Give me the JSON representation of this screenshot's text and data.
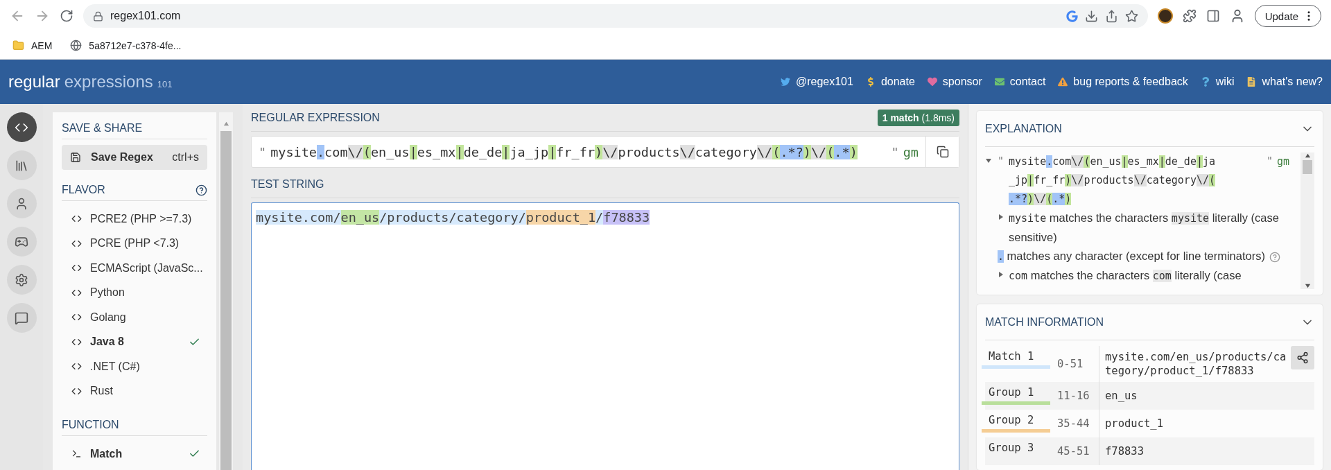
{
  "browser": {
    "address": "regex101.com",
    "update_button": "Update",
    "bookmarks": [
      {
        "label": "AEM",
        "kind": "folder"
      },
      {
        "label": "5a8712e7-c378-4fe...",
        "kind": "site"
      }
    ]
  },
  "header": {
    "logo_main": "regular",
    "logo_sub": "expressions",
    "logo_version": "101",
    "links": [
      {
        "label": "@regex101",
        "kind": "twitter"
      },
      {
        "label": "donate",
        "kind": "donate"
      },
      {
        "label": "sponsor",
        "kind": "sponsor"
      },
      {
        "label": "contact",
        "kind": "contact"
      },
      {
        "label": "bug reports & feedback",
        "kind": "bugs"
      },
      {
        "label": "wiki",
        "kind": "wiki"
      },
      {
        "label": "what's new?",
        "kind": "news"
      }
    ]
  },
  "icon_rail": [
    {
      "kind": "editor",
      "selected": true
    },
    {
      "kind": "library",
      "selected": false
    },
    {
      "kind": "account",
      "selected": false
    },
    {
      "kind": "quiz",
      "selected": false
    },
    {
      "kind": "settings",
      "selected": false
    },
    {
      "kind": "chat",
      "selected": false
    }
  ],
  "sidebar": {
    "save_share": {
      "title": "SAVE & SHARE",
      "save_button": "Save Regex",
      "shortcut": "ctrl+s"
    },
    "flavor": {
      "title": "FLAVOR",
      "items": [
        {
          "label": "PCRE2 (PHP >=7.3)",
          "selected": false
        },
        {
          "label": "PCRE (PHP <7.3)",
          "selected": false
        },
        {
          "label": "ECMAScript (JavaSc...",
          "selected": false
        },
        {
          "label": "Python",
          "selected": false
        },
        {
          "label": "Golang",
          "selected": false
        },
        {
          "label": "Java 8",
          "selected": true
        },
        {
          "label": ".NET (C#)",
          "selected": false
        },
        {
          "label": "Rust",
          "selected": false
        }
      ]
    },
    "function": {
      "title": "FUNCTION",
      "items": [
        {
          "label": "Match",
          "selected": true
        }
      ]
    }
  },
  "regex": {
    "title": "REGULAR EXPRESSION",
    "badge": "**1 match** (1.8ms)",
    "open_delimiter": "\"",
    "close_delimiter": "\"",
    "flags": "gm",
    "tokens": [
      {
        "text": "mysite",
        "kind": "text"
      },
      {
        "text": ".",
        "kind": "meta"
      },
      {
        "text": "com",
        "kind": "text"
      },
      {
        "text": "\\/",
        "kind": "escape"
      },
      {
        "text": "(",
        "kind": "group"
      },
      {
        "text": "en_us",
        "kind": "text"
      },
      {
        "text": "|",
        "kind": "group"
      },
      {
        "text": "es_mx",
        "kind": "text"
      },
      {
        "text": "|",
        "kind": "group"
      },
      {
        "text": "de_de",
        "kind": "text"
      },
      {
        "text": "|",
        "kind": "group"
      },
      {
        "text": "ja_jp",
        "kind": "text"
      },
      {
        "text": "|",
        "kind": "group"
      },
      {
        "text": "fr_fr",
        "kind": "text"
      },
      {
        "text": ")",
        "kind": "group"
      },
      {
        "text": "\\/",
        "kind": "escape"
      },
      {
        "text": "products",
        "kind": "text"
      },
      {
        "text": "\\/",
        "kind": "escape"
      },
      {
        "text": "category",
        "kind": "text"
      },
      {
        "text": "\\/",
        "kind": "escape"
      },
      {
        "text": "(",
        "kind": "group"
      },
      {
        "text": ".*?",
        "kind": "meta"
      },
      {
        "text": ")",
        "kind": "group"
      },
      {
        "text": "\\/",
        "kind": "escape"
      },
      {
        "text": "(",
        "kind": "group"
      },
      {
        "text": ".*",
        "kind": "meta"
      },
      {
        "text": ")",
        "kind": "group"
      }
    ]
  },
  "test_string": {
    "title": "TEST STRING",
    "segments": [
      {
        "text": "mysite.com/",
        "color": "#d6e9fc"
      },
      {
        "text": "en_us",
        "color": "#c4e6a5"
      },
      {
        "text": "/products/category/",
        "color": "#d6e9fc"
      },
      {
        "text": "product_1",
        "color": "#f7d6a8"
      },
      {
        "text": "/",
        "color": "#d6e9fc"
      },
      {
        "text": "f78833",
        "color": "#c7c1f7"
      }
    ]
  },
  "explanation": {
    "title": "EXPLANATION",
    "expanded": true,
    "open_delimiter": "\"",
    "close_delimiter": "\"",
    "flags": "gm",
    "regex_lines": [
      [
        {
          "text": "mysite",
          "kind": "text"
        },
        {
          "text": ".",
          "kind": "meta"
        },
        {
          "text": "com",
          "kind": "text"
        },
        {
          "text": "\\/",
          "kind": "escape"
        },
        {
          "text": "(",
          "kind": "group"
        },
        {
          "text": "en_us",
          "kind": "text"
        },
        {
          "text": "|",
          "kind": "group"
        },
        {
          "text": "es_mx",
          "kind": "text"
        },
        {
          "text": "|",
          "kind": "group"
        },
        {
          "text": "de_de",
          "kind": "text"
        },
        {
          "text": "|",
          "kind": "group"
        },
        {
          "text": "ja",
          "kind": "text"
        }
      ],
      [
        {
          "text": "_jp",
          "kind": "text"
        },
        {
          "text": "|",
          "kind": "group"
        },
        {
          "text": "fr_fr",
          "kind": "text"
        },
        {
          "text": ")",
          "kind": "group"
        },
        {
          "text": "\\/",
          "kind": "escape"
        },
        {
          "text": "products",
          "kind": "text"
        },
        {
          "text": "\\/",
          "kind": "escape"
        },
        {
          "text": "category",
          "kind": "text"
        },
        {
          "text": "\\/",
          "kind": "escape"
        },
        {
          "text": "(",
          "kind": "group"
        }
      ],
      [
        {
          "text": ".*?",
          "kind": "meta"
        },
        {
          "text": ")",
          "kind": "group"
        },
        {
          "text": "\\/",
          "kind": "escape"
        },
        {
          "text": "(",
          "kind": "group"
        },
        {
          "text": ".*",
          "kind": "meta"
        },
        {
          "text": ")",
          "kind": "group"
        }
      ]
    ],
    "items": [
      {
        "kind": "node",
        "expanded": false,
        "help": false,
        "parts": [
          {
            "text": "mysite",
            "kind": "code"
          },
          {
            "text": " matches the characters ",
            "kind": "text"
          },
          {
            "text": "mysite",
            "kind": "literal"
          },
          {
            "text": " literally (case sensitive)",
            "kind": "text"
          }
        ]
      },
      {
        "kind": "leaf",
        "help": true,
        "parts": [
          {
            "text": ".",
            "kind": "meta"
          },
          {
            "text": " matches any character (except for line terminators)",
            "kind": "text"
          }
        ]
      },
      {
        "kind": "node",
        "expanded": false,
        "help": false,
        "parts": [
          {
            "text": "com",
            "kind": "code"
          },
          {
            "text": " matches the characters ",
            "kind": "text"
          },
          {
            "text": "com",
            "kind": "literal"
          },
          {
            "text": " literally (case",
            "kind": "text"
          }
        ]
      }
    ]
  },
  "match_information": {
    "title": "MATCH INFORMATION",
    "rows": [
      {
        "label": "Match 1",
        "range": "0-51",
        "value": "mysite.com/en_us/products/category/product_1/f78833",
        "color": "#d0e6fb"
      },
      {
        "label": "Group 1",
        "range": "11-16",
        "value": "en_us",
        "color": "#b9df9b"
      },
      {
        "label": "Group 2",
        "range": "35-44",
        "value": "product_1",
        "color": "#f5cd94"
      },
      {
        "label": "Group 3",
        "range": "45-51",
        "value": "f78833"
      }
    ]
  }
}
